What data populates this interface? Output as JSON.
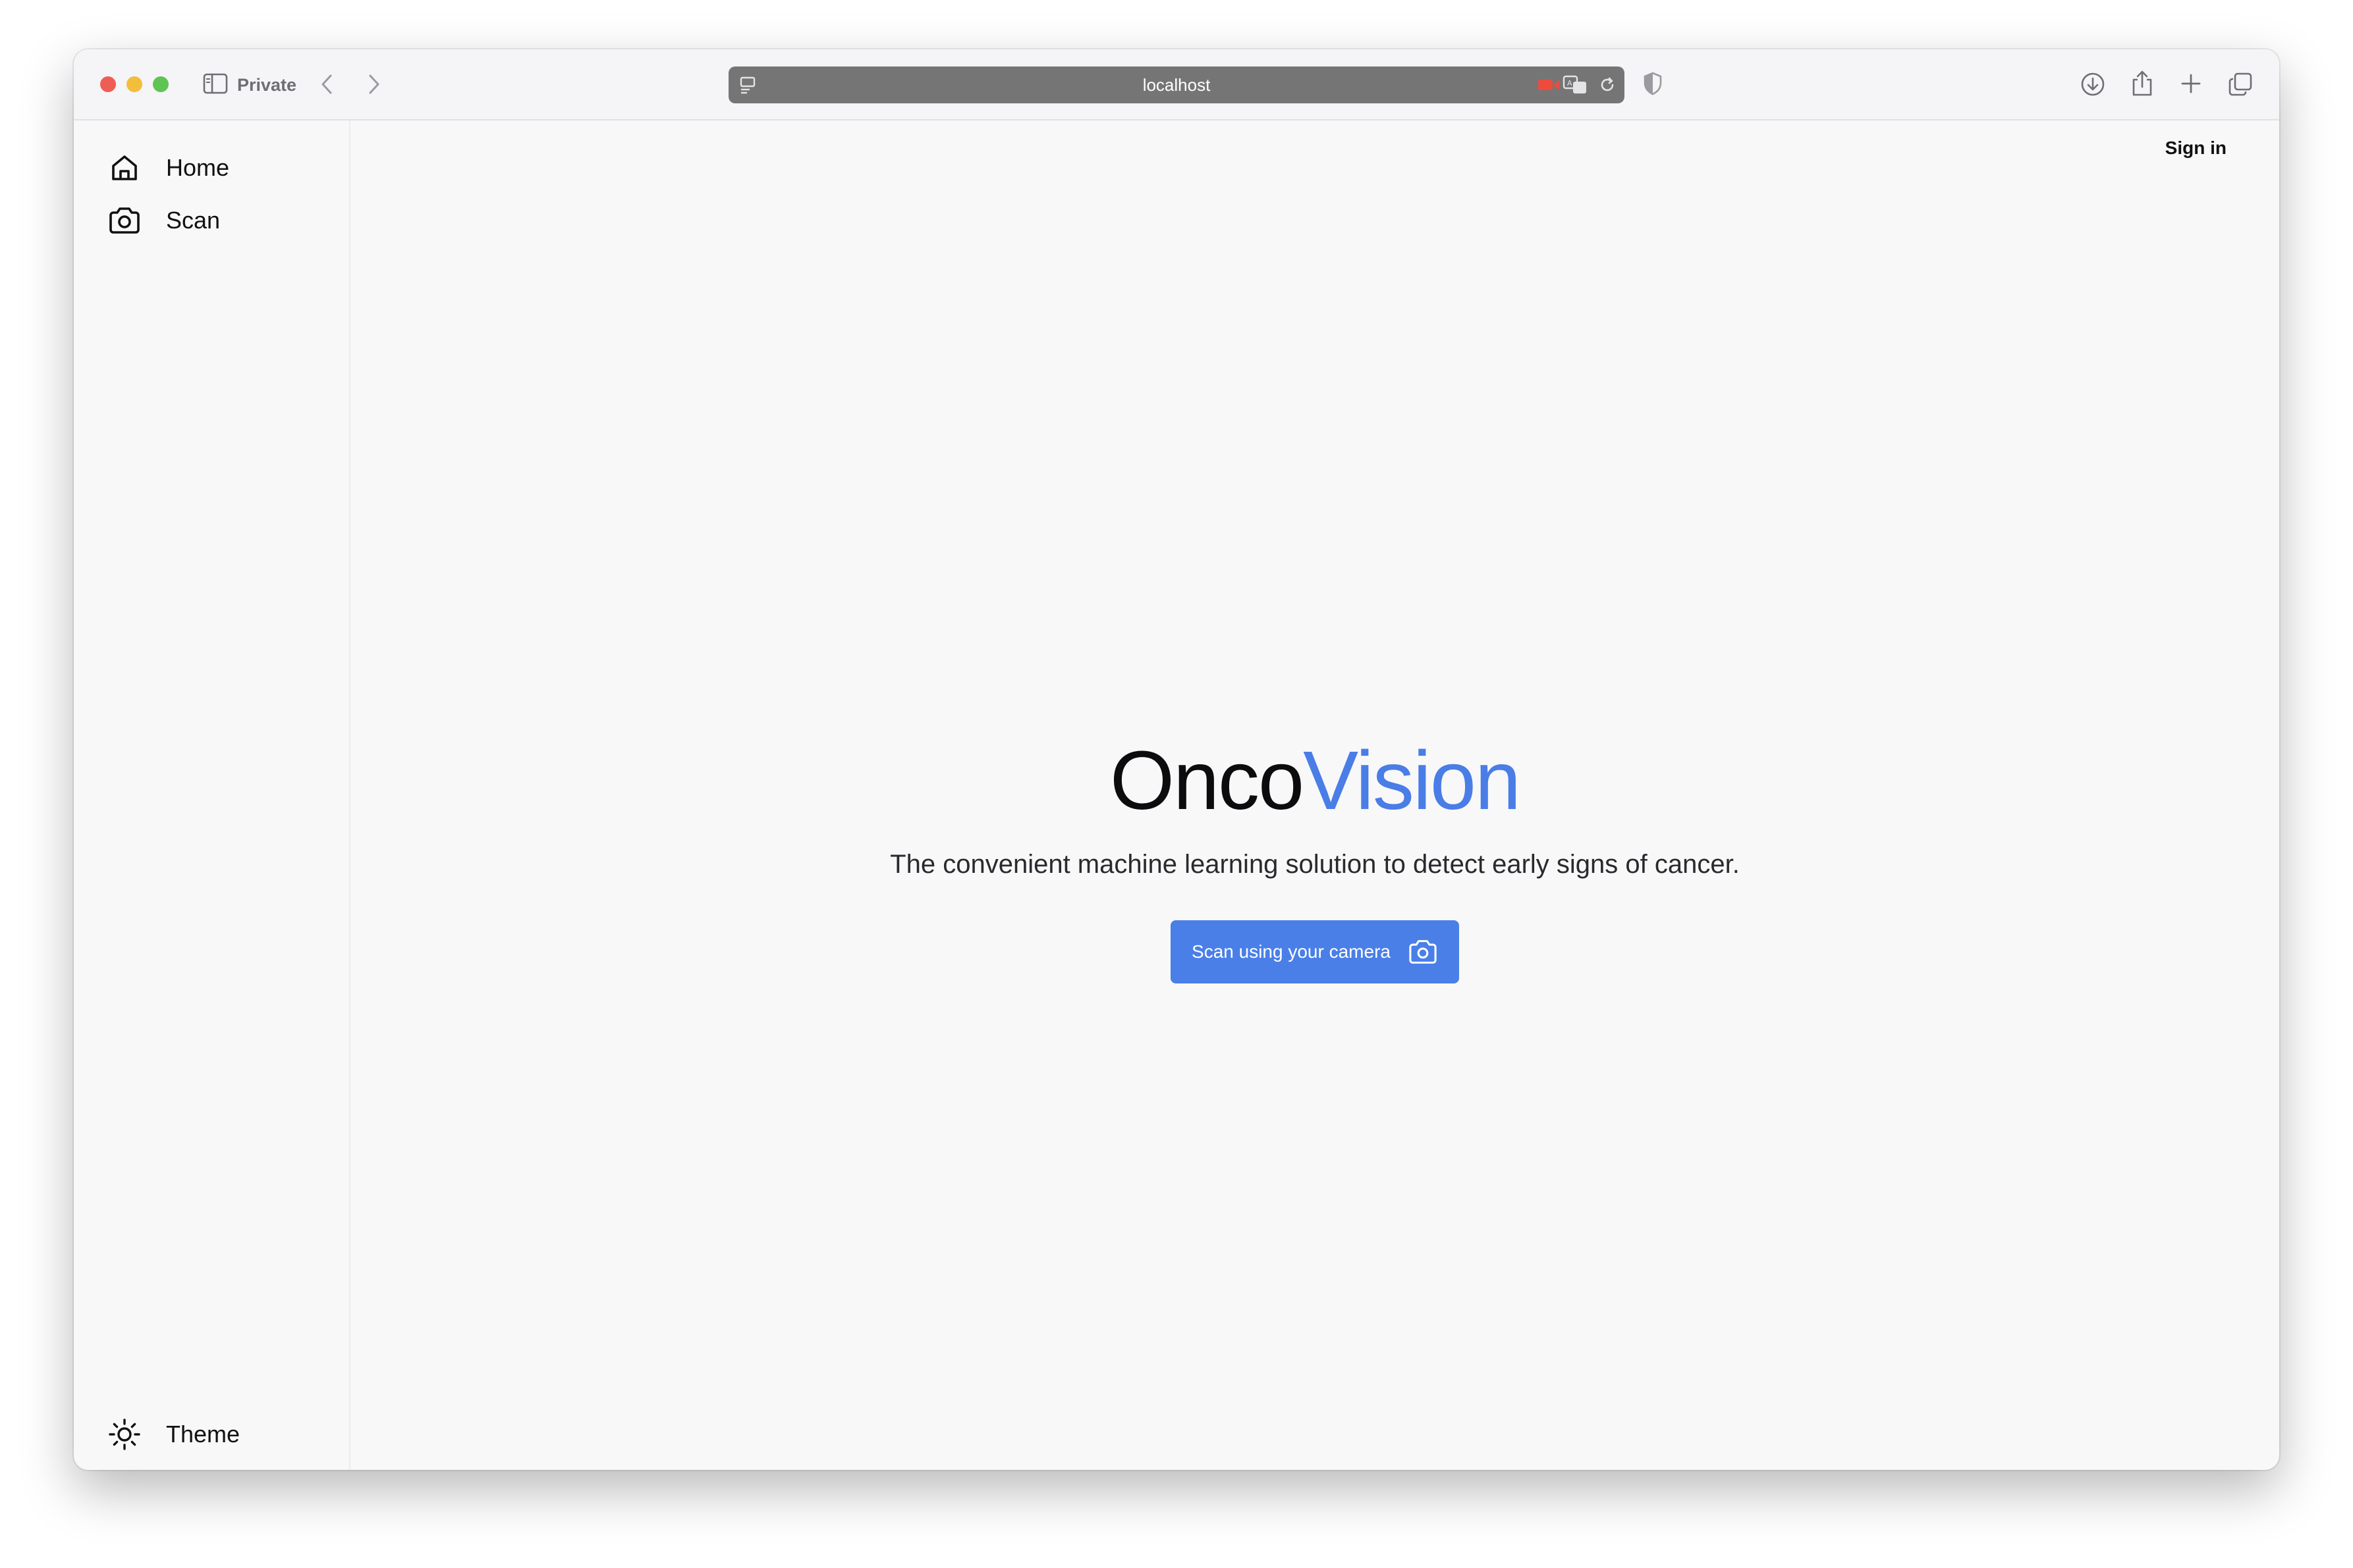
{
  "browser": {
    "mode_label": "Private",
    "url": "localhost"
  },
  "sidebar": {
    "items": [
      {
        "label": "Home",
        "icon": "home-icon"
      },
      {
        "label": "Scan",
        "icon": "camera-icon"
      }
    ],
    "footer": {
      "label": "Theme",
      "icon": "sun-icon"
    }
  },
  "header": {
    "signin_label": "Sign in"
  },
  "hero": {
    "title_part1": "Onco",
    "title_part2": "Vision",
    "subtitle": "The convenient machine learning solution to detect early signs of cancer.",
    "cta_label": "Scan using your camera"
  },
  "colors": {
    "accent": "#4a7fe8",
    "title_dark": "#0c0c0e",
    "traffic_red": "#ee5e55",
    "traffic_yellow": "#f2be3b",
    "traffic_green": "#5fc453"
  }
}
